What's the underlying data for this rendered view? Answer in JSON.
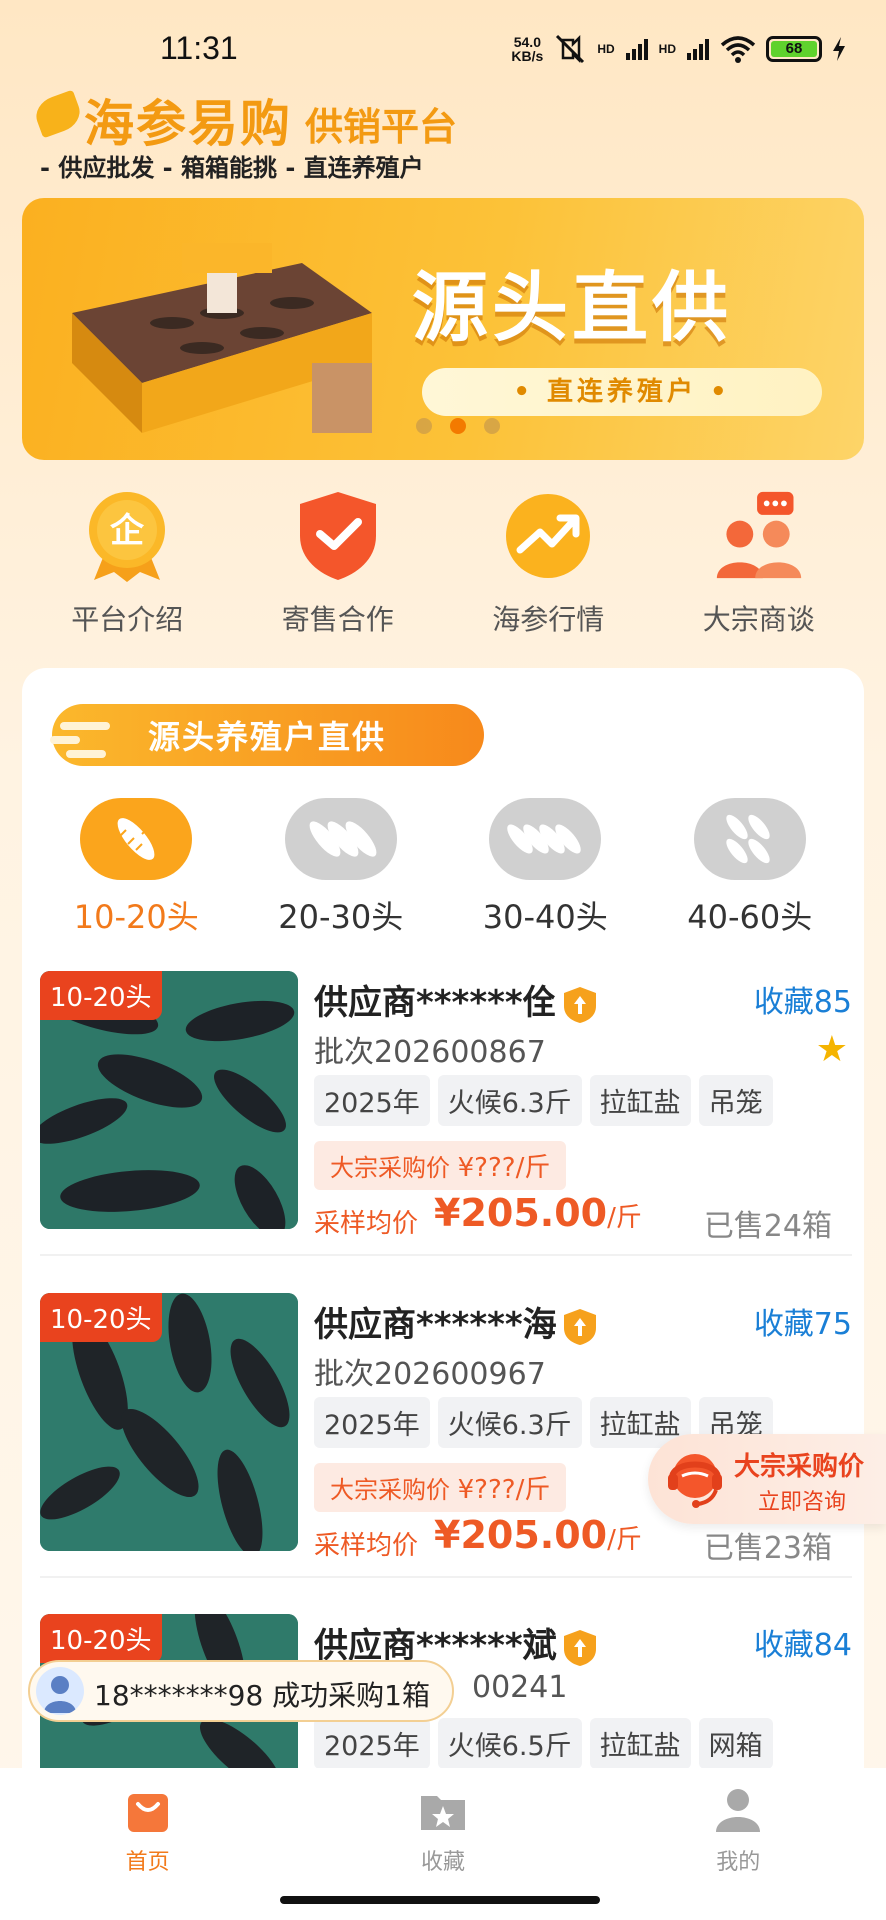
{
  "status_bar": {
    "time": "11:31",
    "net_speed_top": "54.0",
    "net_speed_bottom": "KB/s",
    "signal1": "HD",
    "signal2": "HD",
    "battery": "68"
  },
  "header": {
    "brand": "海参易购",
    "brand_sub": "供销平台",
    "slogan": "- 供应批发 - 箱箱能挑 - 直连养殖户"
  },
  "banner": {
    "title": "源头直供",
    "pill": "• 直连养殖户 •",
    "active_index": 1
  },
  "menu": [
    {
      "label": "平台介绍",
      "icon": "enterprise-badge-icon"
    },
    {
      "label": "寄售合作",
      "icon": "shield-check-icon"
    },
    {
      "label": "海参行情",
      "icon": "trend-up-icon"
    },
    {
      "label": "大宗商谈",
      "icon": "group-chat-icon"
    }
  ],
  "section": {
    "title": "源头养殖户直供"
  },
  "categories": [
    {
      "label": "10-20头",
      "active": true
    },
    {
      "label": "20-30头",
      "active": false
    },
    {
      "label": "30-40头",
      "active": false
    },
    {
      "label": "40-60头",
      "active": false
    }
  ],
  "products": [
    {
      "tag": "10-20头",
      "supplier": "供应商******佺",
      "fav": "收藏85",
      "batch": "批次202600867",
      "chips": [
        "2025年",
        "火候6.3斤",
        "拉缸盐",
        "吊笼"
      ],
      "bulk_label": "大宗采购价",
      "bulk_price": "¥???/斤",
      "avg_label": "采样均价",
      "avg_price": "¥205.00",
      "avg_unit": "/斤",
      "sold": "已售24箱"
    },
    {
      "tag": "10-20头",
      "supplier": "供应商******海",
      "fav": "收藏75",
      "batch": "批次202600967",
      "chips": [
        "2025年",
        "火候6.3斤",
        "拉缸盐",
        "吊笼"
      ],
      "bulk_label": "大宗采购价",
      "bulk_price": "¥???/斤",
      "avg_label": "采样均价",
      "avg_price": "¥205.00",
      "avg_unit": "/斤",
      "sold": "已售23箱"
    },
    {
      "tag": "10-20头",
      "supplier": "供应商******斌",
      "fav": "收藏84",
      "batch": "00241",
      "chips": [
        "2025年",
        "火候6.5斤",
        "拉缸盐",
        "网箱"
      ]
    }
  ],
  "consult": {
    "line1": "大宗采购价",
    "line2": "立即咨询"
  },
  "toast": {
    "text": "18*******98 成功采购1箱"
  },
  "tabbar": [
    {
      "label": "首页",
      "active": true
    },
    {
      "label": "收藏",
      "active": false
    },
    {
      "label": "我的",
      "active": false
    }
  ]
}
